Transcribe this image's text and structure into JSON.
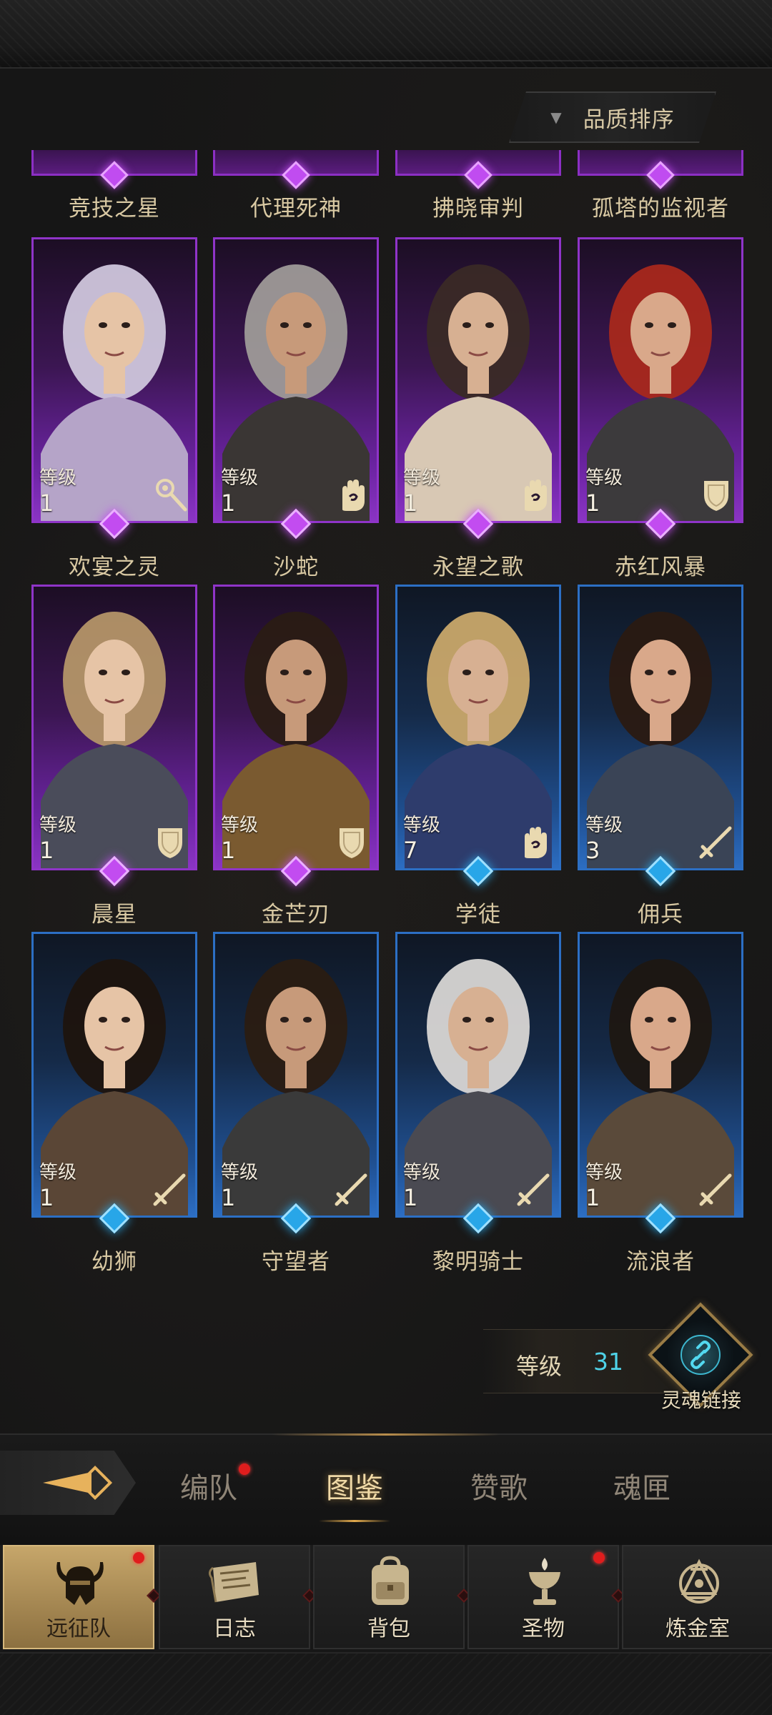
{
  "sort_button": {
    "label": "品质排序"
  },
  "clipped_row": [
    {
      "name": "竞技之星",
      "rarity": "purple"
    },
    {
      "name": "代理死神",
      "rarity": "purple"
    },
    {
      "name": "拂晓审判",
      "rarity": "purple"
    },
    {
      "name": "孤塔的监视者",
      "rarity": "purple"
    }
  ],
  "heroes": [
    {
      "name": "欢宴之灵",
      "level_label": "等级",
      "level": "1",
      "rarity": "purple",
      "class_icon": "staff-icon"
    },
    {
      "name": "沙蛇",
      "level_label": "等级",
      "level": "1",
      "rarity": "purple",
      "class_icon": "hand-icon"
    },
    {
      "name": "永望之歌",
      "level_label": "等级",
      "level": "1",
      "rarity": "purple",
      "class_icon": "hand-icon"
    },
    {
      "name": "赤红风暴",
      "level_label": "等级",
      "level": "1",
      "rarity": "purple",
      "class_icon": "shield-icon"
    },
    {
      "name": "晨星",
      "level_label": "等级",
      "level": "1",
      "rarity": "purple",
      "class_icon": "shield-icon"
    },
    {
      "name": "金芒刃",
      "level_label": "等级",
      "level": "1",
      "rarity": "purple",
      "class_icon": "shield-icon"
    },
    {
      "name": "学徒",
      "level_label": "等级",
      "level": "7",
      "rarity": "blue",
      "class_icon": "hand-icon"
    },
    {
      "name": "佣兵",
      "level_label": "等级",
      "level": "3",
      "rarity": "blue",
      "class_icon": "sword-icon"
    },
    {
      "name": "幼狮",
      "level_label": "等级",
      "level": "1",
      "rarity": "blue",
      "class_icon": "sword-icon"
    },
    {
      "name": "守望者",
      "level_label": "等级",
      "level": "1",
      "rarity": "blue",
      "class_icon": "sword-icon"
    },
    {
      "name": "黎明骑士",
      "level_label": "等级",
      "level": "1",
      "rarity": "blue",
      "class_icon": "sword-icon"
    },
    {
      "name": "流浪者",
      "level_label": "等级",
      "level": "1",
      "rarity": "blue",
      "class_icon": "sword-icon"
    }
  ],
  "level_panel": {
    "label": "等级",
    "value": "31"
  },
  "soul_link": {
    "label": "灵魂链接"
  },
  "sub_tabs": [
    {
      "label": "编队",
      "badge": true
    },
    {
      "label": "图鉴",
      "active": true
    },
    {
      "label": "赞歌"
    },
    {
      "label": "魂匣"
    }
  ],
  "bottom_nav": [
    {
      "label": "远征队",
      "icon": "horned-helmet-icon",
      "active": true,
      "badge": true
    },
    {
      "label": "日志",
      "icon": "scroll-map-icon"
    },
    {
      "label": "背包",
      "icon": "backpack-icon"
    },
    {
      "label": "圣物",
      "icon": "chalice-icon",
      "badge": true
    },
    {
      "label": "炼金室",
      "icon": "alchemy-icon"
    }
  ],
  "colors": {
    "purple_rarity": "#8f34c8",
    "blue_rarity": "#2c6fc4",
    "level_value": "#4fd2e8",
    "gold_text": "#d9c9a3",
    "badge_red": "#e01d1d"
  }
}
